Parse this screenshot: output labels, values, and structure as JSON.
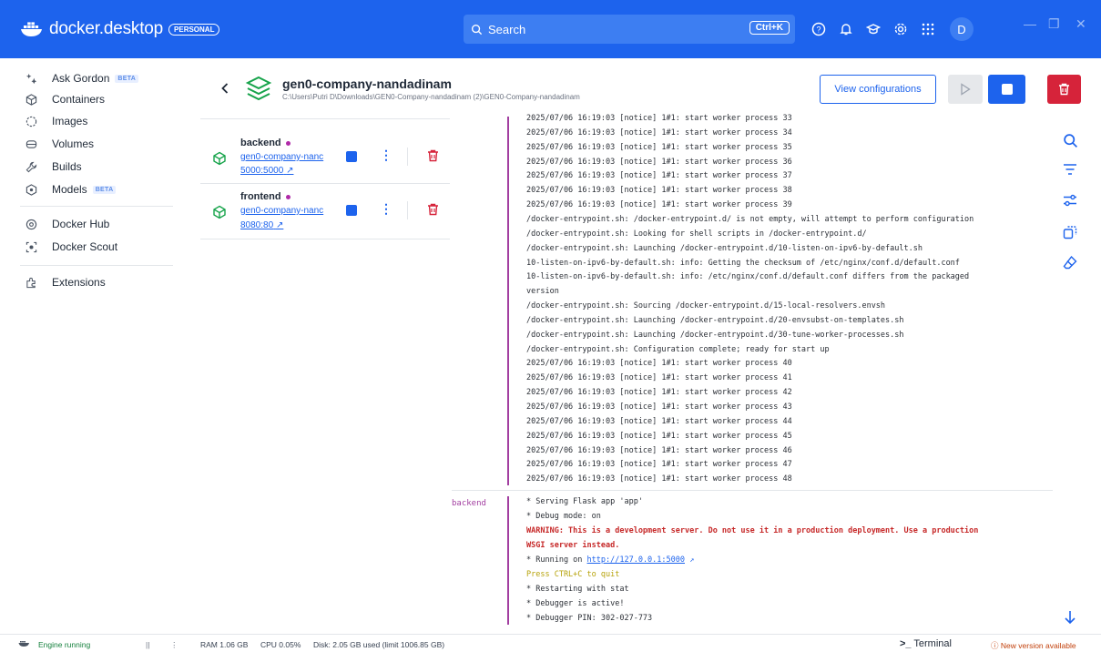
{
  "app": {
    "brand": "docker.desktop",
    "badge": "PERSONAL",
    "search_placeholder": "Search",
    "search_shortcut": "Ctrl+K",
    "avatar_initial": "D"
  },
  "sidebar": {
    "items": [
      {
        "label": "Ask Gordon",
        "beta": "BETA",
        "icon": "sparkle-icon"
      },
      {
        "label": "Containers",
        "icon": "container-icon"
      },
      {
        "label": "Images",
        "icon": "images-icon"
      },
      {
        "label": "Volumes",
        "icon": "volumes-icon"
      },
      {
        "label": "Builds",
        "icon": "builds-icon"
      },
      {
        "label": "Models",
        "beta": "BETA",
        "icon": "models-icon"
      },
      {
        "label": "Docker Hub",
        "icon": "hub-icon"
      },
      {
        "label": "Docker Scout",
        "icon": "scout-icon"
      },
      {
        "label": "Extensions",
        "icon": "extensions-icon"
      }
    ]
  },
  "project": {
    "title": "gen0-company-nandadinam",
    "path": "C:\\Users\\Putri D\\Downloads\\GEN0-Company-nandadinam (2)\\GEN0-Company-nandadinam",
    "view_config_label": "View configurations"
  },
  "containers": [
    {
      "name": "backend",
      "link": "gen0-company-nanc",
      "port": "5000:5000"
    },
    {
      "name": "frontend",
      "link": "gen0-company-nanc",
      "port": "8080:80"
    }
  ],
  "logs": {
    "frontend_lines": [
      "2025/07/06 16:19:03 [notice] 1#1: start worker process 33",
      "2025/07/06 16:19:03 [notice] 1#1: start worker process 34",
      "2025/07/06 16:19:03 [notice] 1#1: start worker process 35",
      "2025/07/06 16:19:03 [notice] 1#1: start worker process 36",
      "2025/07/06 16:19:03 [notice] 1#1: start worker process 37",
      "2025/07/06 16:19:03 [notice] 1#1: start worker process 38",
      "2025/07/06 16:19:03 [notice] 1#1: start worker process 39",
      "/docker-entrypoint.sh: /docker-entrypoint.d/ is not empty, will attempt to perform configuration",
      "/docker-entrypoint.sh: Looking for shell scripts in /docker-entrypoint.d/",
      "/docker-entrypoint.sh: Launching /docker-entrypoint.d/10-listen-on-ipv6-by-default.sh",
      "10-listen-on-ipv6-by-default.sh: info: Getting the checksum of /etc/nginx/conf.d/default.conf",
      "10-listen-on-ipv6-by-default.sh: info: /etc/nginx/conf.d/default.conf differs from the packaged",
      "version",
      "/docker-entrypoint.sh: Sourcing /docker-entrypoint.d/15-local-resolvers.envsh",
      "/docker-entrypoint.sh: Launching /docker-entrypoint.d/20-envsubst-on-templates.sh",
      "/docker-entrypoint.sh: Launching /docker-entrypoint.d/30-tune-worker-processes.sh",
      "/docker-entrypoint.sh: Configuration complete; ready for start up",
      "2025/07/06 16:19:03 [notice] 1#1: start worker process 40",
      "2025/07/06 16:19:03 [notice] 1#1: start worker process 41",
      "2025/07/06 16:19:03 [notice] 1#1: start worker process 42",
      "2025/07/06 16:19:03 [notice] 1#1: start worker process 43",
      "2025/07/06 16:19:03 [notice] 1#1: start worker process 44",
      "2025/07/06 16:19:03 [notice] 1#1: start worker process 45",
      "2025/07/06 16:19:03 [notice] 1#1: start worker process 46",
      "2025/07/06 16:19:03 [notice] 1#1: start worker process 47",
      "2025/07/06 16:19:03 [notice] 1#1: start worker process 48"
    ],
    "backend_label": "backend",
    "backend_lines": [
      {
        "text": " * Serving Flask app 'app'",
        "style": "normal"
      },
      {
        "text": " * Debug mode: on",
        "style": "normal"
      },
      {
        "text": "WARNING: This is a development server. Do not use it in a production deployment. Use a production",
        "style": "warn"
      },
      {
        "text": "WSGI server instead.",
        "style": "warn"
      },
      {
        "text": " * Running on ",
        "style": "normal",
        "link": "http://127.0.0.1:5000"
      },
      {
        "text": "Press CTRL+C to quit",
        "style": "yellow"
      },
      {
        "text": " * Restarting with stat",
        "style": "normal"
      },
      {
        "text": " * Debugger is active!",
        "style": "normal"
      },
      {
        "text": " * Debugger PIN: 302-027-773",
        "style": "normal"
      }
    ]
  },
  "status": {
    "engine": "Engine running",
    "ram": "RAM 1.06 GB",
    "cpu": "CPU 0.05%",
    "disk": "Disk: 2.05 GB used (limit 1006.85 GB)",
    "terminal": "Terminal",
    "update": "New version available"
  },
  "colors": {
    "brand_blue": "#1d63ed",
    "danger_red": "#d6233a",
    "log_purple": "#a23ea0"
  }
}
